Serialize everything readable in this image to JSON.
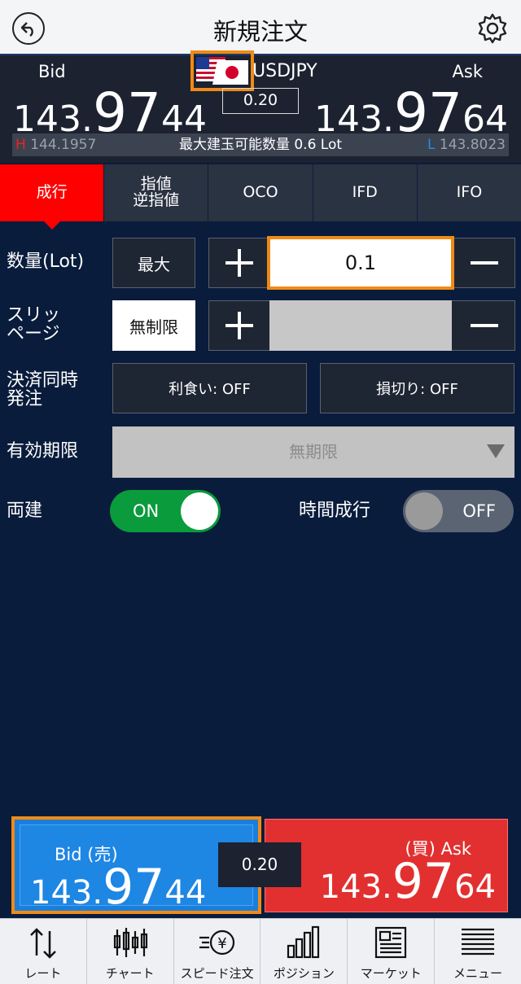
{
  "header": {
    "title": "新規注文",
    "back_icon": "back-arrow-icon",
    "settings_icon": "gear-icon"
  },
  "rate": {
    "pair": "USDJPY",
    "bid_label": "Bid",
    "ask_label": "Ask",
    "spread": "0.20",
    "bid_price": {
      "head": "143.",
      "big": "97",
      "tail": "44"
    },
    "ask_price": {
      "head": "143.",
      "big": "97",
      "tail": "64"
    },
    "high_tag": "H",
    "high": "144.1957",
    "low_tag": "L",
    "low": "143.8023",
    "max_lot": "最大建玉可能数量 0.6 Lot"
  },
  "tabs": [
    {
      "label": "成行",
      "active": true
    },
    {
      "label": "指値\n逆指値",
      "active": false
    },
    {
      "label": "OCO",
      "active": false
    },
    {
      "label": "IFD",
      "active": false
    },
    {
      "label": "IFO",
      "active": false
    }
  ],
  "form": {
    "qty_label": "数量(Lot)",
    "max_button": "最大",
    "qty_value": "0.1",
    "slip_label_1": "スリッ",
    "slip_label_2": "ページ",
    "slip_button": "無制限",
    "settle_label_1": "決済同時",
    "settle_label_2": "発注",
    "take_profit": "利食い: OFF",
    "stop_loss": "損切り: OFF",
    "expiry_label": "有効期限",
    "expiry_value": "無期限",
    "hedge_label": "両建",
    "hedge_state": "ON",
    "time_market_label": "時間成行",
    "time_market_state": "OFF"
  },
  "trade": {
    "bid_label": "Bid (売)",
    "ask_label": "(買) Ask",
    "spread": "0.20",
    "bid_price": {
      "head": "143.",
      "big": "97",
      "tail": "44"
    },
    "ask_price": {
      "head": "143.",
      "big": "97",
      "tail": "64"
    }
  },
  "nav": [
    {
      "label": "レート",
      "icon": "rate-arrows-icon"
    },
    {
      "label": "チャート",
      "icon": "candlestick-icon"
    },
    {
      "label": "スピード注文",
      "icon": "speed-order-icon"
    },
    {
      "label": "ポジション",
      "icon": "bar-chart-icon"
    },
    {
      "label": "マーケット",
      "icon": "newspaper-icon"
    },
    {
      "label": "メニュー",
      "icon": "menu-icon"
    }
  ],
  "colors": {
    "background": "#0a1c3c",
    "accent_orange": "#f08a16",
    "bid_blue": "#1e86e3",
    "ask_red": "#e23030",
    "toggle_on": "#0a9b3c"
  }
}
